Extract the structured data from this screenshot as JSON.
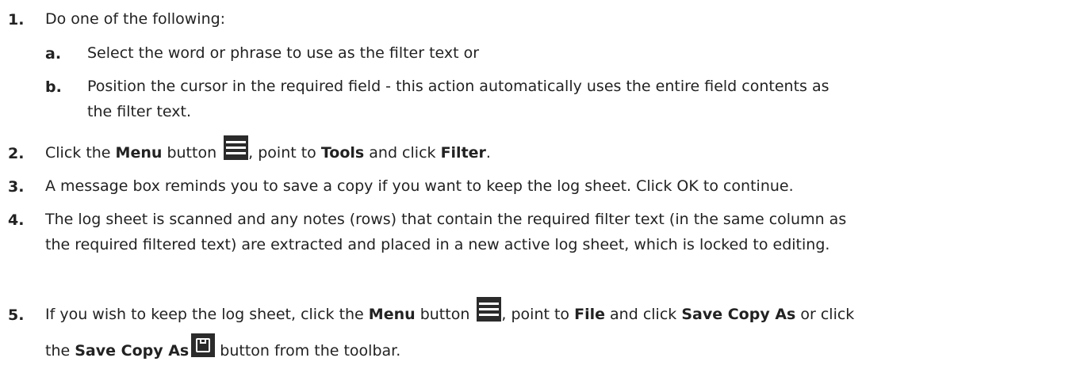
{
  "steps": [
    {
      "num": "1.",
      "text": "Do one of the following:",
      "sub": [
        {
          "num": "a.",
          "text": "Select the word or phrase to use as the filter text or"
        },
        {
          "num": "b.",
          "line1": "Position the cursor in the required field - this action automatically uses the entire field contents as",
          "line2": "the filter text."
        }
      ]
    },
    {
      "num": "2.",
      "p1": "Click the ",
      "b1": "Menu",
      "p2": " button ",
      "p3": ", point to ",
      "b2": "Tools",
      "p4": " and click ",
      "b3": "Filter",
      "p5": "."
    },
    {
      "num": "3.",
      "text": "A message box reminds you to save a copy if you want to keep the log sheet.  Click OK to continue."
    },
    {
      "num": "4.",
      "line1": "The log sheet is scanned and any notes (rows) that contain the required filter text (in the same column as",
      "line2": "the required filtered text) are extracted and placed in a new active log sheet, which is locked to editing."
    },
    {
      "num": "5.",
      "p1": "If you wish to keep the log sheet, click the ",
      "b1": "Menu",
      "p2": " button ",
      "p3": ", point to ",
      "b2": "File",
      "p4": " and click ",
      "b3": "Save Copy As",
      "p5": " or click",
      "p6": "the ",
      "b4": "Save Copy As",
      "p7": " button from the toolbar."
    }
  ],
  "icons": {
    "menu": "menu-hamburger-icon",
    "save": "save-floppy-icon"
  },
  "colors": {
    "text": "#222222",
    "icon_bg": "#2b2b2b"
  }
}
